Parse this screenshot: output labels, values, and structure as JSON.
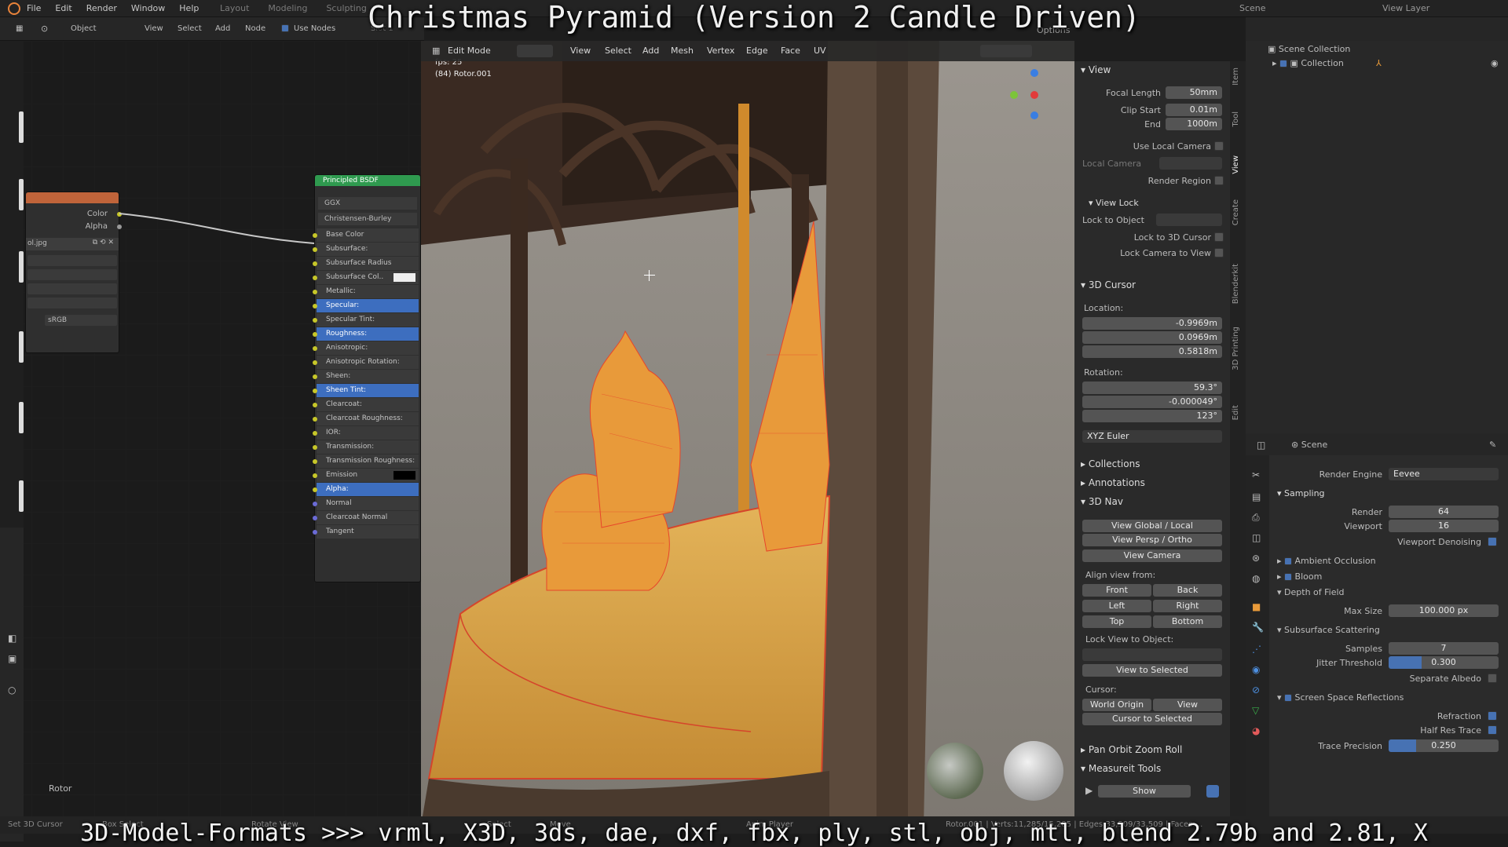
{
  "video": {
    "title": "Christmas Pyramid (Version 2 Candle Driven)",
    "caption": "3D-Model-Formats >>> vrml, X3D, 3ds, dae, dxf, fbx, ply, stl, obj, mtl, blend 2.79b and 2.81, X"
  },
  "topbar": {
    "menus": [
      "File",
      "Edit",
      "Render",
      "Window",
      "Help"
    ],
    "workspaces": [
      "Layout",
      "Modeling",
      "Sculpting"
    ],
    "scene": "Scene",
    "view_layer": "View Layer"
  },
  "node_header": {
    "editor": "Object",
    "menus": [
      "View",
      "Select",
      "Add",
      "Node"
    ],
    "use_nodes": "Use Nodes",
    "slot": "Slot 1"
  },
  "image_node": {
    "outputs": [
      "Color",
      "Alpha"
    ],
    "image": "ol.jpg",
    "colorspace": "sRGB"
  },
  "bsdf": {
    "title": "Principled BSDF",
    "distribution": "GGX",
    "subsurface_method": "Christensen-Burley",
    "inputs": [
      "Base Color",
      "Subsurface:",
      "Subsurface Radius",
      "Subsurface Col..",
      "Metallic:",
      "Specular:",
      "Specular Tint:",
      "Roughness:",
      "Anisotropic:",
      "Anisotropic Rotation:",
      "Sheen:",
      "Sheen Tint:",
      "Clearcoat:",
      "Clearcoat Roughness:",
      "IOR:",
      "Transmission:",
      "Transmission Roughness:",
      "Emission",
      "Alpha:",
      "Normal",
      "Clearcoat Normal",
      "Tangent"
    ]
  },
  "node_label": "Rotor",
  "viewport": {
    "mode": "Edit Mode",
    "menus": [
      "View",
      "Select",
      "Add",
      "Mesh",
      "Vertex",
      "Edge",
      "Face",
      "UV"
    ],
    "fps": "fps: 25",
    "object": "(84) Rotor.001",
    "options": "Options"
  },
  "npanel": {
    "tabs": [
      "Item",
      "Tool",
      "View",
      "Create",
      "Blenderkit",
      "3D Printing",
      "Edit"
    ],
    "view_header": "View",
    "focal_label": "Focal Length",
    "focal": "50mm",
    "clip_start_label": "Clip Start",
    "clip_start": "0.01m",
    "clip_end_label": "End",
    "clip_end": "1000m",
    "use_local_camera": "Use Local Camera",
    "local_camera": "Local Camera",
    "render_region": "Render Region",
    "view_lock": "View Lock",
    "lock_object": "Lock to Object",
    "lock_cursor": "Lock to 3D Cursor",
    "lock_camera": "Lock Camera to View",
    "cursor_header": "3D Cursor",
    "location": "Location:",
    "loc_x": "-0.9969m",
    "loc_y": "0.0969m",
    "loc_z": "0.5818m",
    "rotation": "Rotation:",
    "rot_x": "59.3°",
    "rot_y": "-0.000049°",
    "rot_z": "123°",
    "rot_mode": "XYZ Euler",
    "collections": "Collections",
    "annotations": "Annotations",
    "nav": "3D Nav",
    "view_global": "View Global / Local",
    "view_persp": "View Persp / Ortho",
    "view_camera": "View Camera",
    "align_from": "Align view from:",
    "front": "Front",
    "back": "Back",
    "left": "Left",
    "right": "Right",
    "top": "Top",
    "bottom": "Bottom",
    "lock_view": "Lock View to Object:",
    "view_selected": "View to Selected",
    "cursor": "Cursor:",
    "world_origin": "World Origin",
    "view": "View",
    "cursor_selected": "Cursor to Selected",
    "pan_orbit": "Pan Orbit Zoom Roll",
    "measureit": "Measureit Tools",
    "show": "Show"
  },
  "outliner": {
    "root": "Scene Collection",
    "collection": "Collection"
  },
  "props": {
    "scene": "Scene",
    "render_engine_label": "Render Engine",
    "render_engine": "Eevee",
    "sampling": "Sampling",
    "render_label": "Render",
    "render": "64",
    "viewport_label": "Viewport",
    "viewport": "16",
    "viewport_denoising": "Viewport Denoising",
    "ao": "Ambient Occlusion",
    "bloom": "Bloom",
    "dof": "Depth of Field",
    "max_size_label": "Max Size",
    "max_size": "100.000 px",
    "sss": "Subsurface Scattering",
    "samples_label": "Samples",
    "samples": "7",
    "jitter_label": "Jitter Threshold",
    "jitter": "0.300",
    "separate_albedo": "Separate Albedo",
    "ssr": "Screen Space Reflections",
    "refraction": "Refraction",
    "half_res": "Half Res Trace",
    "trace_label": "Trace Precision",
    "trace": "0.250"
  },
  "status": {
    "set_3d_cursor": "Set 3D Cursor",
    "box_select": "Box Select",
    "rotate_view": "Rotate View",
    "select": "Select",
    "move": "Move",
    "anim_player": "Anim Player",
    "stats": "Rotor.001 | Verts:11,285/15,285 | Edges:33,509/33,509 | Faces:..."
  },
  "colors": {
    "accent": "#4772b3",
    "bsdf_header": "#2f9a4f",
    "image_header": "#c0643a",
    "mesh_orange": "#e89a3a",
    "wire": "#e8452a"
  }
}
